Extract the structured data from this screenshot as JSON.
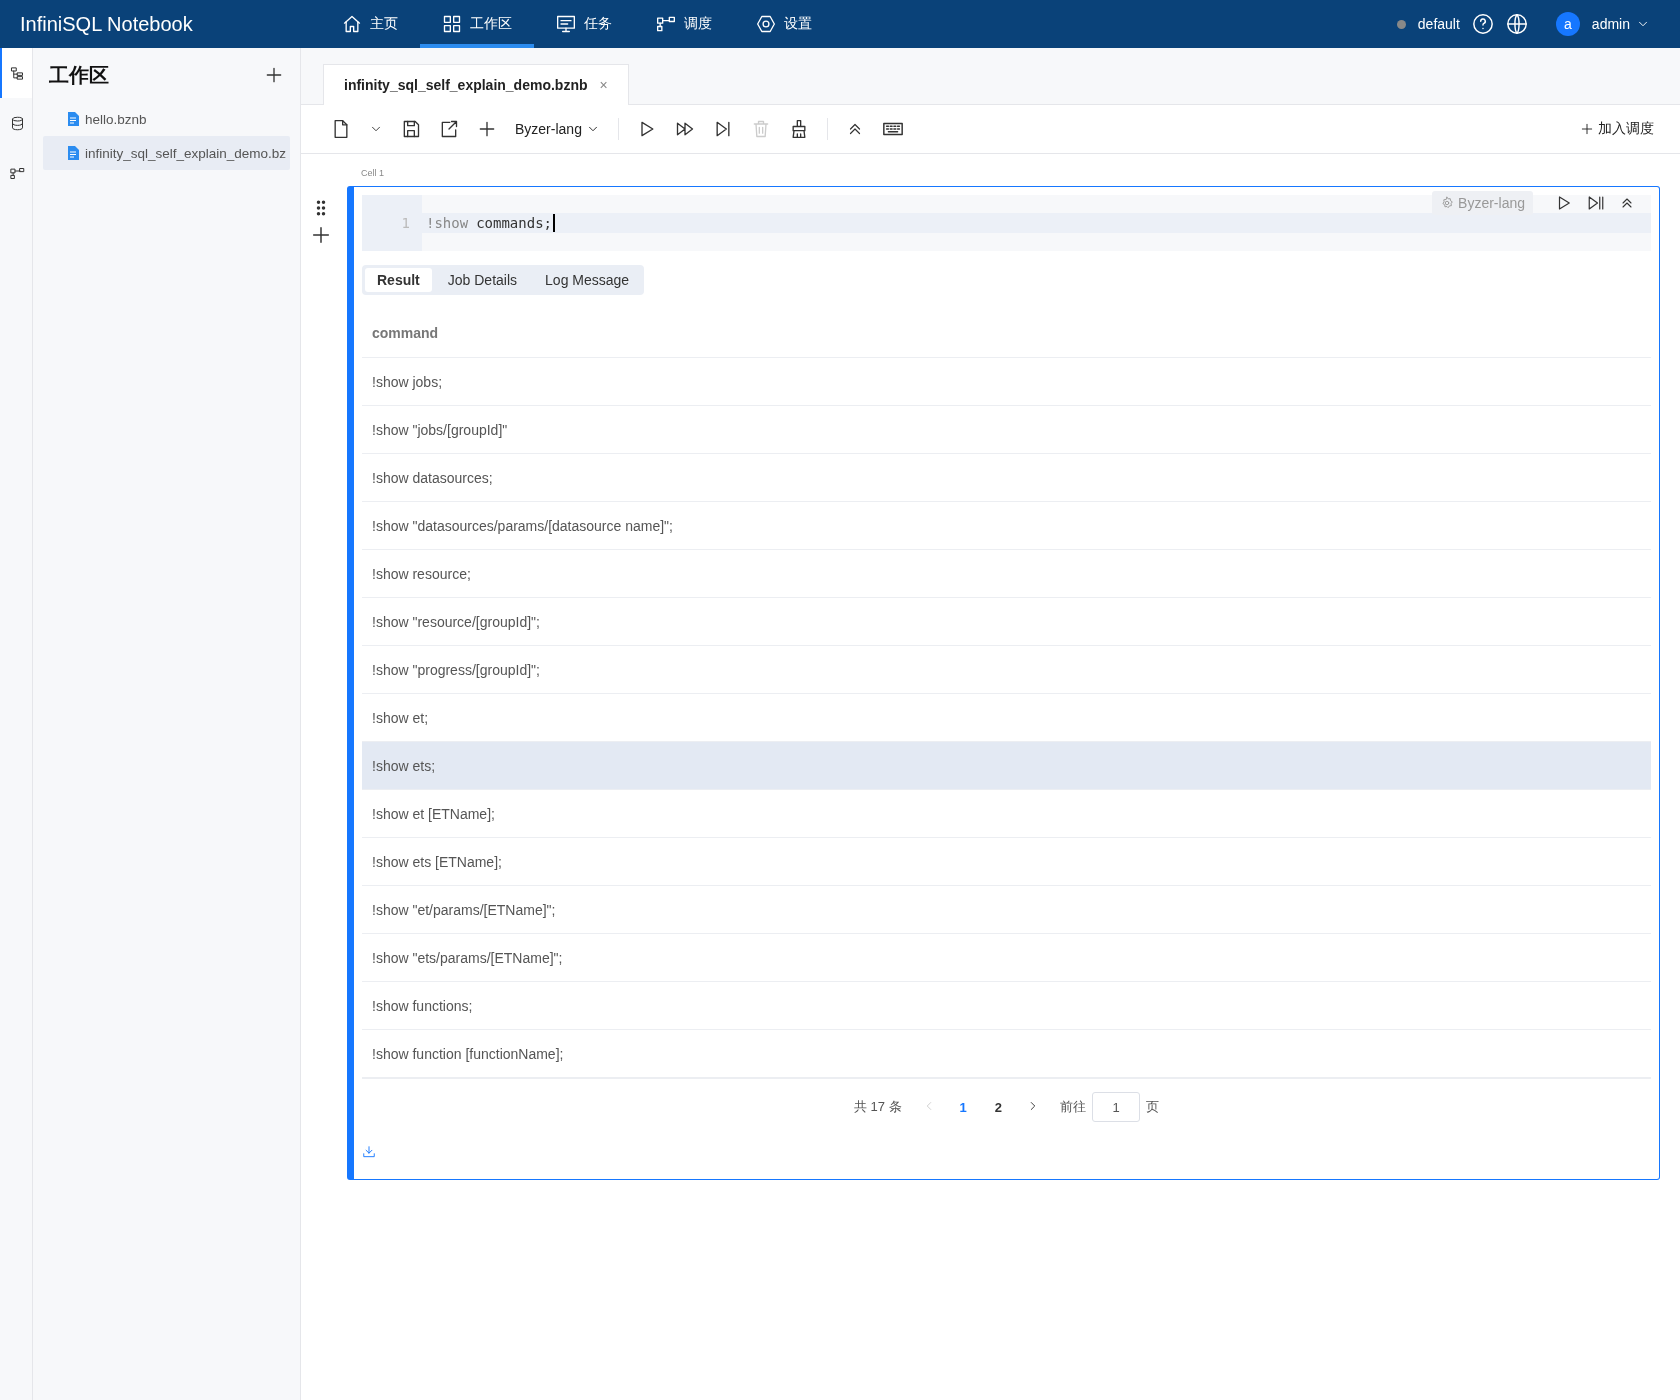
{
  "app": {
    "title": "InfiniSQL Notebook"
  },
  "nav": [
    {
      "label": "主页",
      "selected": false
    },
    {
      "label": "工作区",
      "selected": true
    },
    {
      "label": "任务",
      "selected": false
    },
    {
      "label": "调度",
      "selected": false
    },
    {
      "label": "设置",
      "selected": false
    }
  ],
  "header_right": {
    "workspace": "default",
    "user_initial": "a",
    "user": "admin"
  },
  "rail": [
    {
      "selected": true
    },
    {
      "selected": false
    },
    {
      "selected": false
    }
  ],
  "sidebar": {
    "title": "工作区",
    "files": [
      {
        "name": "hello.bznb",
        "selected": false
      },
      {
        "name": "infinity_sql_self_explain_demo.bz",
        "selected": true
      }
    ]
  },
  "editor_tabs": [
    {
      "label": "infinity_sql_self_explain_demo.bznb",
      "close": "×",
      "selected": true
    }
  ],
  "toolbar": {
    "language": "Byzer-lang",
    "schedule": "加入调度"
  },
  "cell": {
    "label": "Cell 1",
    "line_number": "1",
    "code_keyword": "!show",
    "code_rest": "commands;",
    "language": "Byzer-lang",
    "tabs": [
      {
        "label": "Result",
        "selected": true
      },
      {
        "label": "Job Details",
        "selected": false
      },
      {
        "label": "Log Message",
        "selected": false
      }
    ],
    "table": {
      "columns": [
        "command"
      ],
      "rows": [
        {
          "command": "!show jobs;",
          "highlighted": false
        },
        {
          "command": "!show \"jobs/[groupId]\"",
          "highlighted": false
        },
        {
          "command": "!show datasources;",
          "highlighted": false
        },
        {
          "command": "!show \"datasources/params/[datasource name]\";",
          "highlighted": false
        },
        {
          "command": "!show resource;",
          "highlighted": false
        },
        {
          "command": "!show \"resource/[groupId]\";",
          "highlighted": false
        },
        {
          "command": "!show \"progress/[groupId]\";",
          "highlighted": false
        },
        {
          "command": "!show et;",
          "highlighted": false
        },
        {
          "command": "!show ets;",
          "highlighted": true
        },
        {
          "command": "!show et [ETName];",
          "highlighted": false
        },
        {
          "command": "!show ets [ETName];",
          "highlighted": false
        },
        {
          "command": "!show \"et/params/[ETName]\";",
          "highlighted": false
        },
        {
          "command": "!show \"ets/params/[ETName]\";",
          "highlighted": false
        },
        {
          "command": "!show functions;",
          "highlighted": false
        },
        {
          "command": "!show function [functionName];",
          "highlighted": false
        }
      ]
    },
    "pagination": {
      "total": "共 17 条",
      "pages": [
        {
          "label": "1",
          "selected": true
        },
        {
          "label": "2",
          "selected": false
        }
      ],
      "goto_label": "前往",
      "goto_value": "1",
      "goto_suffix": "页"
    }
  }
}
